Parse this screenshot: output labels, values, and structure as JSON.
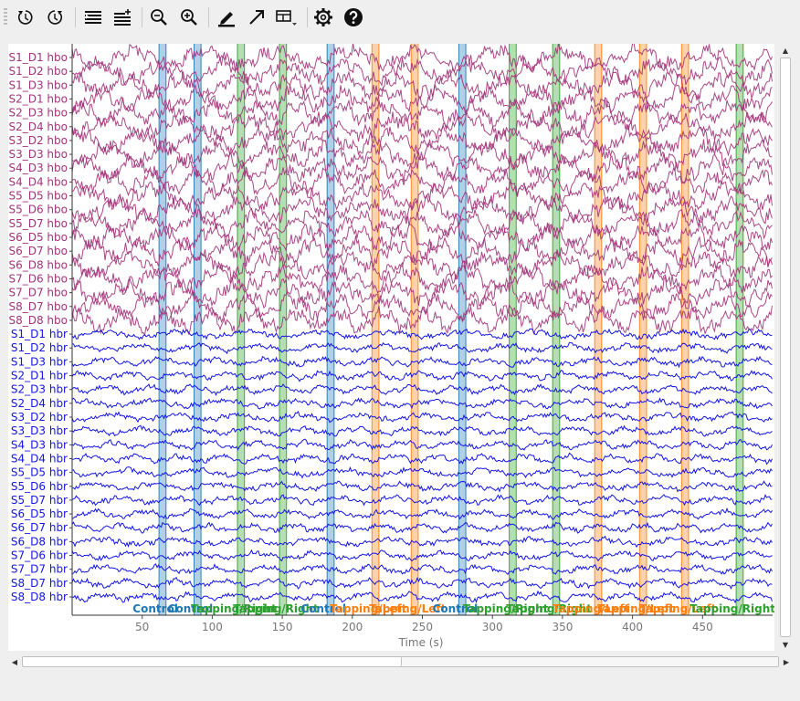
{
  "toolbar": {
    "buttons": [
      {
        "name": "rewind-icon"
      },
      {
        "name": "fast-forward-icon"
      },
      {
        "name": "fewer-channels-icon"
      },
      {
        "name": "more-channels-icon"
      },
      {
        "name": "zoom-out-icon"
      },
      {
        "name": "zoom-in-icon"
      },
      {
        "name": "annotate-pencil-icon"
      },
      {
        "name": "arrow-up-right-icon"
      },
      {
        "name": "projector-menu-icon"
      },
      {
        "name": "settings-gear-icon"
      },
      {
        "name": "help-icon"
      }
    ]
  },
  "colors": {
    "hbo": "#a23379",
    "hbr": "#1515e6",
    "Control": "#1f77b4",
    "Tapping/Left": "#ff7f0e",
    "Tapping/Right": "#2ca02c"
  },
  "chart_data": {
    "type": "line",
    "xlabel": "Time (s)",
    "xlim": [
      0,
      500
    ],
    "xticks": [
      50,
      100,
      150,
      200,
      250,
      300,
      350,
      400,
      450
    ],
    "channels": [
      {
        "label": "S1_D1 hbo",
        "type": "hbo"
      },
      {
        "label": "S1_D2 hbo",
        "type": "hbo"
      },
      {
        "label": "S1_D3 hbo",
        "type": "hbo"
      },
      {
        "label": "S2_D1 hbo",
        "type": "hbo"
      },
      {
        "label": "S2_D3 hbo",
        "type": "hbo"
      },
      {
        "label": "S2_D4 hbo",
        "type": "hbo"
      },
      {
        "label": "S3_D2 hbo",
        "type": "hbo"
      },
      {
        "label": "S3_D3 hbo",
        "type": "hbo"
      },
      {
        "label": "S4_D3 hbo",
        "type": "hbo"
      },
      {
        "label": "S4_D4 hbo",
        "type": "hbo"
      },
      {
        "label": "S5_D5 hbo",
        "type": "hbo"
      },
      {
        "label": "S5_D6 hbo",
        "type": "hbo"
      },
      {
        "label": "S5_D7 hbo",
        "type": "hbo"
      },
      {
        "label": "S6_D5 hbo",
        "type": "hbo"
      },
      {
        "label": "S6_D7 hbo",
        "type": "hbo"
      },
      {
        "label": "S6_D8 hbo",
        "type": "hbo"
      },
      {
        "label": "S7_D6 hbo",
        "type": "hbo"
      },
      {
        "label": "S7_D7 hbo",
        "type": "hbo"
      },
      {
        "label": "S8_D7 hbo",
        "type": "hbo"
      },
      {
        "label": "S8_D8 hbo",
        "type": "hbo"
      },
      {
        "label": "S1_D1 hbr",
        "type": "hbr"
      },
      {
        "label": "S1_D2 hbr",
        "type": "hbr"
      },
      {
        "label": "S1_D3 hbr",
        "type": "hbr"
      },
      {
        "label": "S2_D1 hbr",
        "type": "hbr"
      },
      {
        "label": "S2_D3 hbr",
        "type": "hbr"
      },
      {
        "label": "S2_D4 hbr",
        "type": "hbr"
      },
      {
        "label": "S3_D2 hbr",
        "type": "hbr"
      },
      {
        "label": "S3_D3 hbr",
        "type": "hbr"
      },
      {
        "label": "S4_D3 hbr",
        "type": "hbr"
      },
      {
        "label": "S4_D4 hbr",
        "type": "hbr"
      },
      {
        "label": "S5_D5 hbr",
        "type": "hbr"
      },
      {
        "label": "S5_D6 hbr",
        "type": "hbr"
      },
      {
        "label": "S5_D7 hbr",
        "type": "hbr"
      },
      {
        "label": "S6_D5 hbr",
        "type": "hbr"
      },
      {
        "label": "S6_D7 hbr",
        "type": "hbr"
      },
      {
        "label": "S6_D8 hbr",
        "type": "hbr"
      },
      {
        "label": "S7_D6 hbr",
        "type": "hbr"
      },
      {
        "label": "S7_D7 hbr",
        "type": "hbr"
      },
      {
        "label": "S8_D7 hbr",
        "type": "hbr"
      },
      {
        "label": "S8_D8 hbr",
        "type": "hbr"
      }
    ],
    "annotations": [
      {
        "onset": 62,
        "duration": 5,
        "label": "Control"
      },
      {
        "onset": 87,
        "duration": 5,
        "label": "Control"
      },
      {
        "onset": 118,
        "duration": 5,
        "label": "Tapping/Right"
      },
      {
        "onset": 148,
        "duration": 5,
        "label": "Tapping/Right"
      },
      {
        "onset": 182,
        "duration": 5,
        "label": "Control"
      },
      {
        "onset": 214,
        "duration": 5,
        "label": "Tapping/Left"
      },
      {
        "onset": 242,
        "duration": 5,
        "label": "Tapping/Left"
      },
      {
        "onset": 276,
        "duration": 5,
        "label": "Control"
      },
      {
        "onset": 312,
        "duration": 5,
        "label": "Tapping/Right"
      },
      {
        "onset": 343,
        "duration": 5,
        "label": "Tapping/Right"
      },
      {
        "onset": 373,
        "duration": 5,
        "label": "Tapping/Left"
      },
      {
        "onset": 405,
        "duration": 5,
        "label": "Tapping/Left"
      },
      {
        "onset": 435,
        "duration": 5,
        "label": "Tapping/Left"
      },
      {
        "onset": 474,
        "duration": 5,
        "label": "Tapping/Right"
      }
    ]
  }
}
